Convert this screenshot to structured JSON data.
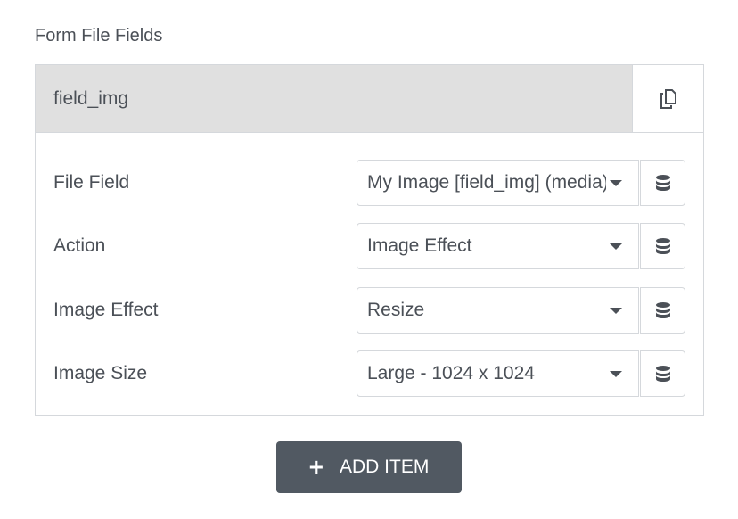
{
  "section_title": "Form File Fields",
  "item": {
    "title": "field_img",
    "duplicate_icon": "copy-icon"
  },
  "rows": [
    {
      "label": "File Field",
      "value": "My Image [field_img] (media)"
    },
    {
      "label": "Action",
      "value": "Image Effect"
    },
    {
      "label": "Image Effect",
      "value": "Resize"
    },
    {
      "label": "Image Size",
      "value": "Large - 1024 x 1024"
    }
  ],
  "dynamic_icon": "database-icon",
  "add_button": {
    "icon": "+",
    "label": "ADD ITEM"
  },
  "colors": {
    "header_bg": "#e0e0e0",
    "button_bg": "#515962"
  }
}
